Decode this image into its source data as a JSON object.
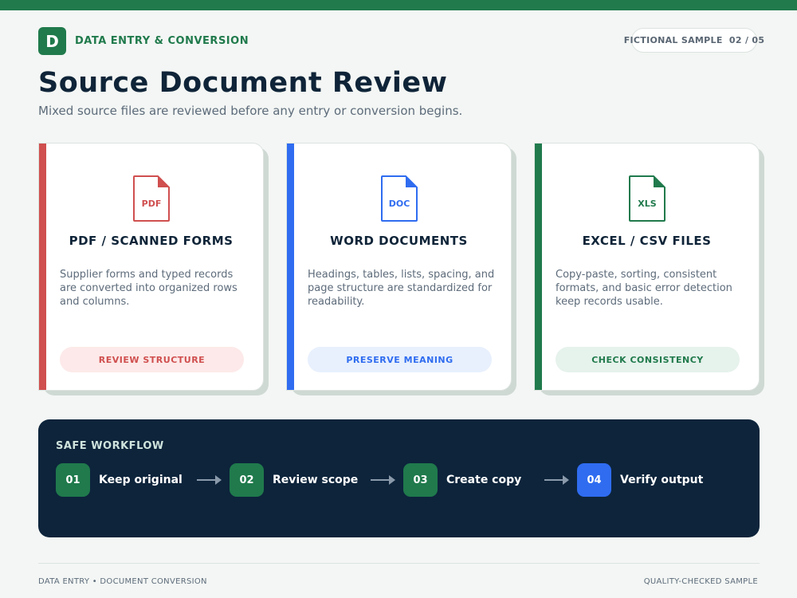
{
  "header": {
    "logo_letter": "D",
    "brand": "DATA ENTRY & CONVERSION",
    "sample_label": "FICTIONAL SAMPLE",
    "page_indicator": "02 / 05",
    "title": "Source Document Review",
    "subtitle": "Mixed source files are reviewed before any entry or conversion begins."
  },
  "cards": [
    {
      "file_tag": "PDF",
      "title": "PDF / SCANNED FORMS",
      "description": "Supplier forms and typed records are converted into organized rows and columns.",
      "badge": "REVIEW STRUCTURE",
      "accent": "#d04f4f",
      "badge_bg": "#fde9e9"
    },
    {
      "file_tag": "DOC",
      "title": "WORD DOCUMENTS",
      "description": "Headings, tables, lists, spacing, and page structure are standardized for readability.",
      "badge": "PRESERVE MEANING",
      "accent": "#2f6cf0",
      "badge_bg": "#e8f0fd"
    },
    {
      "file_tag": "XLS",
      "title": "EXCEL / CSV FILES",
      "description": "Copy-paste, sorting, consistent formats, and basic error detection keep records usable.",
      "badge": "CHECK CONSISTENCY",
      "accent": "#207a4c",
      "badge_bg": "#e6f2ec"
    }
  ],
  "workflow": {
    "title": "SAFE WORKFLOW",
    "steps": [
      {
        "num": "01",
        "label": "Keep original",
        "color": "#207a4c"
      },
      {
        "num": "02",
        "label": "Review scope",
        "color": "#207a4c"
      },
      {
        "num": "03",
        "label": "Create copy",
        "color": "#207a4c"
      },
      {
        "num": "04",
        "label": "Verify output",
        "color": "#2f6cf0"
      }
    ],
    "arrow_icon": "arrow-right-icon"
  },
  "footer": {
    "left": "DATA ENTRY • DOCUMENT CONVERSION",
    "right": "QUALITY-CHECKED SAMPLE"
  },
  "colors": {
    "brand_green": "#207a4c",
    "navy": "#0d243b",
    "red": "#d04f4f",
    "blue": "#2f6cf0"
  }
}
